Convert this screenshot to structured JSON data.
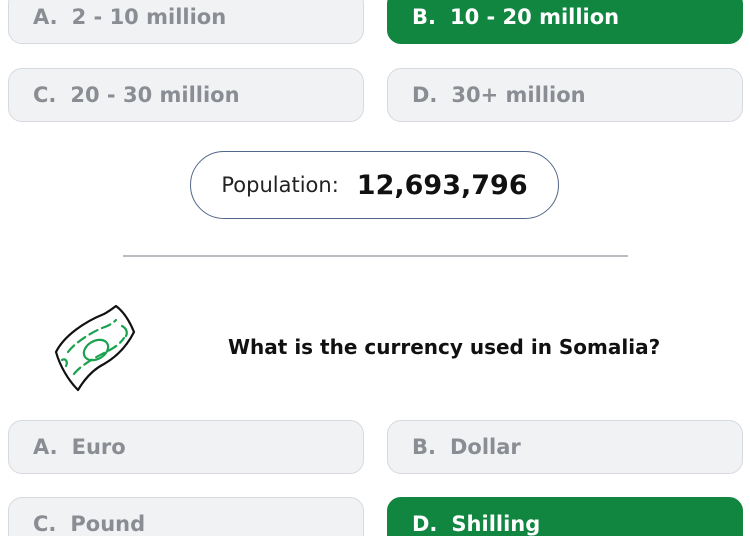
{
  "q1": {
    "options": [
      {
        "letter": "A.",
        "text": "2 - 10 million"
      },
      {
        "letter": "B.",
        "text": "10 - 20 million"
      },
      {
        "letter": "C.",
        "text": "20 - 30 million"
      },
      {
        "letter": "D.",
        "text": "30+ million"
      }
    ],
    "selected": "B"
  },
  "population": {
    "label": "Population:",
    "value": "12,693,796"
  },
  "q2": {
    "icon": "money-bill-icon",
    "question": "What is the currency used in Somalia?",
    "options": [
      {
        "letter": "A.",
        "text": "Euro"
      },
      {
        "letter": "B.",
        "text": "Dollar"
      },
      {
        "letter": "C.",
        "text": "Pound"
      },
      {
        "letter": "D.",
        "text": "Shilling"
      }
    ],
    "selected": "D"
  },
  "colors": {
    "correct": "#118640",
    "option_bg": "#f1f2f4",
    "option_text": "#8a8d93"
  }
}
